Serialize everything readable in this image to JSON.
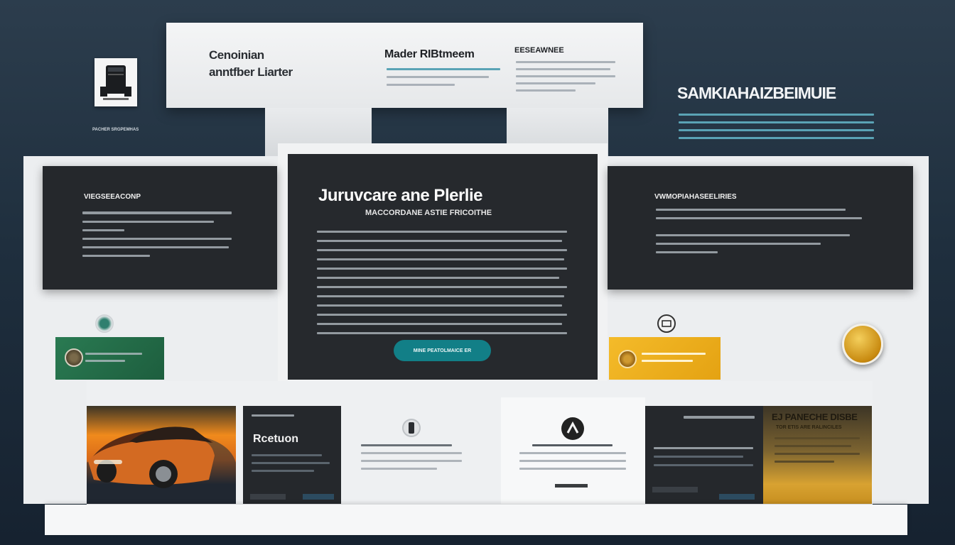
{
  "banner": {
    "title_line_1": "Cenoinian",
    "title_line_2": "anntfber Liarter",
    "column_title": "Mader RIBtmeem",
    "column_small_title": "EESEAWNEE"
  },
  "logo": {
    "caption": "PACHER SRGPEMHAS"
  },
  "right_panel": {
    "heading": "SAMKIAHAIZBEIMUIE"
  },
  "left_card": {
    "heading": "VIEGSEEACONP"
  },
  "right_card": {
    "heading": "VWMOPIAHASEELIRIES"
  },
  "hero": {
    "title": "Juruvcare ane Plerlie",
    "subtitle": "MACCORDANE ASTIE FRICOITHE",
    "cta_label": "MINE PEATOLMAICE ER"
  },
  "bottom": {
    "dark_tile_title": "Rcetuon",
    "gold_tile_heading": "EJ PANECHE DISBE",
    "gold_tile_subheading": "TOR ETIS ARE RALINCILES"
  },
  "icons": {
    "logo": "device-icon",
    "green_badge": "globe-icon",
    "grey_badge": "id-icon",
    "gold_coin": "coin-icon",
    "green_box_icon": "coin-icon",
    "yellow_box_icon": "coin-icon",
    "triangle": "triangle-icon",
    "knob": "knob-icon"
  },
  "colors": {
    "background": "#243645",
    "dark_card": "#25282c",
    "cta": "#127f87",
    "green_box": "#2a7a52",
    "yellow_box": "#f0b323",
    "gold_coin": "#d69b1d"
  }
}
